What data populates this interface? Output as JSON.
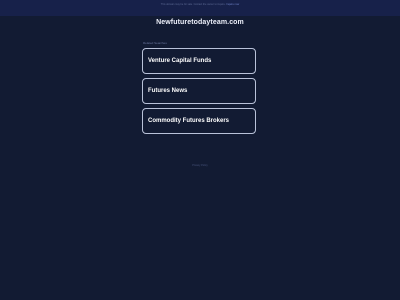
{
  "banner": {
    "text": "This domain may be for sale. Contact the owner to inquire.",
    "link_text": "Inquire now"
  },
  "domain": {
    "title": "Newfuturetodayteam.com"
  },
  "related": {
    "label": "Related Searches",
    "links": [
      {
        "label": "Venture Capital Funds"
      },
      {
        "label": "Futures News"
      },
      {
        "label": "Commodity Futures Brokers"
      }
    ]
  },
  "footer": {
    "privacy_label": "Privacy Policy"
  },
  "colors": {
    "background": "#121b33",
    "banner": "#17214a",
    "card_border": "#b9c2d9",
    "text": "#ffffff"
  }
}
